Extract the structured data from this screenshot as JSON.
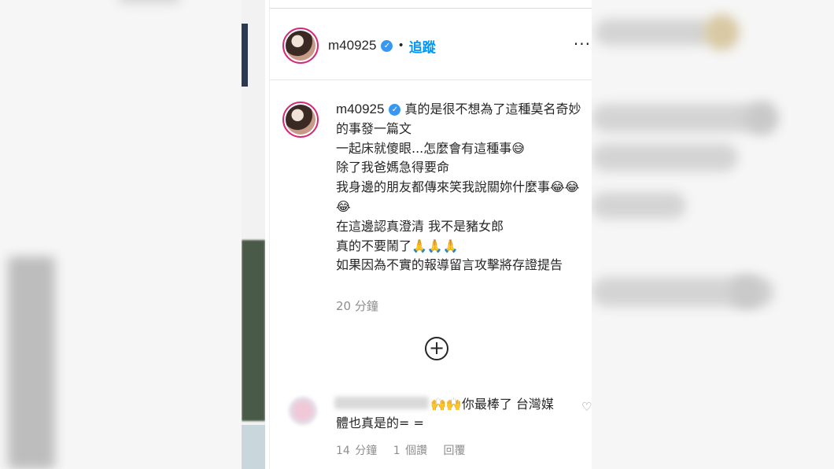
{
  "header": {
    "username": "m40925",
    "separator": "•",
    "follow_label": "追蹤",
    "more_label": "···"
  },
  "post": {
    "username": "m40925",
    "caption_lines": [
      "真的是很不想為了這種莫名奇妙的事發一篇文",
      "一起床就傻眼...怎麼會有這種事😅",
      "除了我爸媽急得要命",
      "我身邊的朋友都傳來笑我說關妳什麼事😂😂😂",
      "在這邊認真澄清 我不是豬女郎",
      "真的不要鬧了🙏🙏🙏",
      "如果因為不實的報導留言攻擊將存證提告"
    ],
    "time": "20 分鐘"
  },
  "load_more_icon": "plus-circle-icon",
  "comment": {
    "text": "🙌🙌你最棒了 台灣媒體也真是的= =",
    "time": "14 分鐘",
    "likes": "1 個讚",
    "reply": "回覆"
  },
  "colors": {
    "accent": "#0095f6",
    "verified": "#3897f0",
    "text": "#262626",
    "muted": "#8e8e8e"
  }
}
